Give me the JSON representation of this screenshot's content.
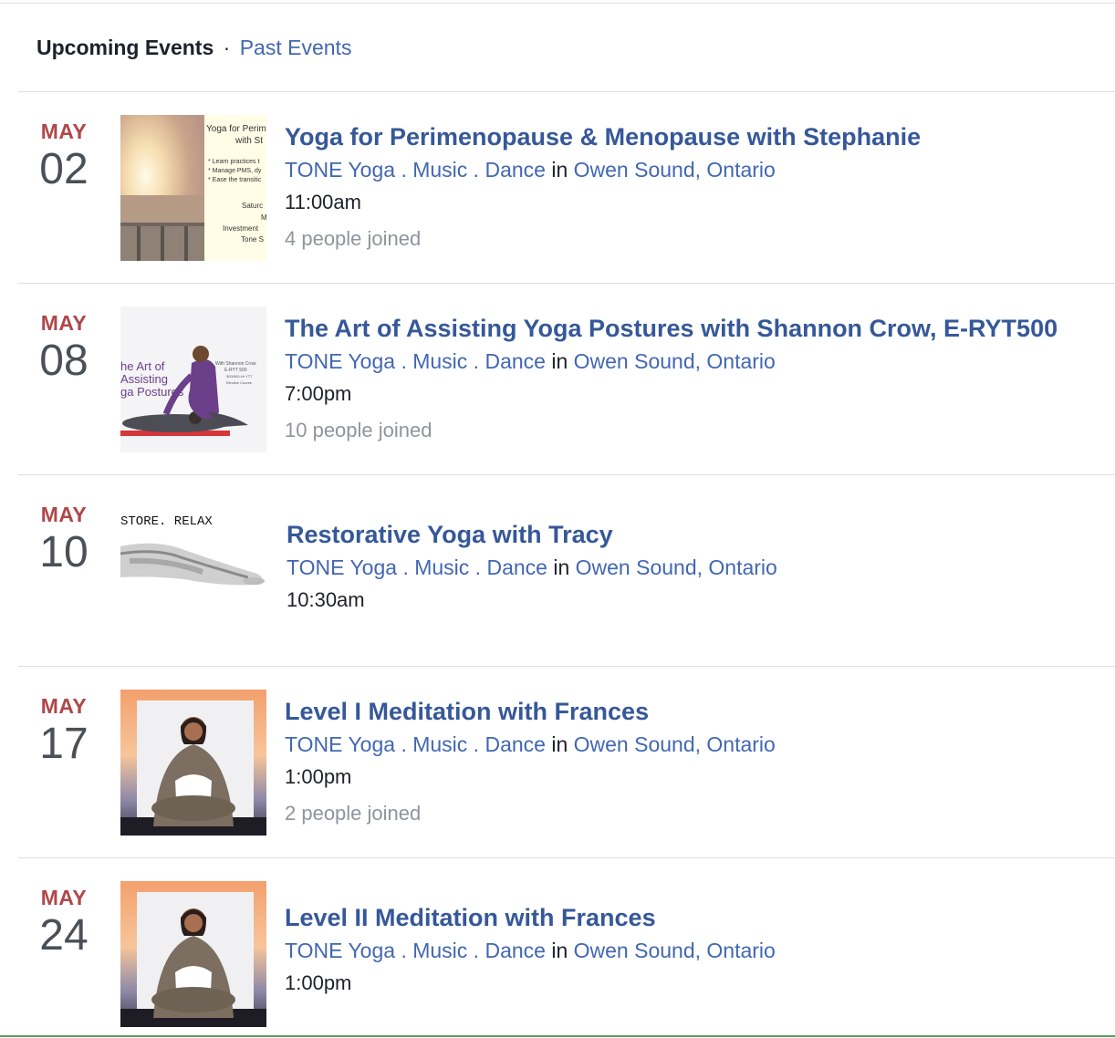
{
  "tabs": {
    "upcoming": "Upcoming Events",
    "separator": "·",
    "past": "Past Events"
  },
  "events": [
    {
      "month": "MAY",
      "day": "02",
      "title": "Yoga for Perimenopause & Menopause with Stephanie",
      "host": "TONE Yoga . Music . Dance",
      "in_word": "in",
      "location": "Owen Sound, Ontario",
      "time": "11:00am",
      "joined": "4 people joined",
      "poster": {
        "title_lines": [
          "Yoga for Perim",
          "with St"
        ],
        "bullets": [
          "* Learn practices t",
          "* Manage PMS, dy",
          "* Ease the transitic"
        ],
        "footer_lines": [
          "Saturc",
          "M",
          "Investment",
          "Tone S"
        ]
      }
    },
    {
      "month": "MAY",
      "day": "08",
      "title": "The Art of Assisting Yoga Postures with Shannon Crow, E-RYT500",
      "host": "TONE Yoga . Music . Dance",
      "in_word": "in",
      "location": "Owen Sound, Ontario",
      "time": "7:00pm",
      "joined": "10 people joined",
      "poster": {
        "title_lines": [
          "he Art of",
          "Assisting",
          "ga Postures"
        ],
        "side_lines": [
          "With Shannon Crow",
          "E-RYT 500",
          "300/500-Hr YTT",
          "Elective Course"
        ]
      }
    },
    {
      "month": "MAY",
      "day": "10",
      "title": "Restorative Yoga with Tracy",
      "host": "TONE Yoga . Music . Dance",
      "in_word": "in",
      "location": "Owen Sound, Ontario",
      "time": "10:30am",
      "joined": "",
      "poster": {
        "caption": "STORE. RELAX"
      }
    },
    {
      "month": "MAY",
      "day": "17",
      "title": "Level I Meditation with Frances",
      "host": "TONE Yoga . Music . Dance",
      "in_word": "in",
      "location": "Owen Sound, Ontario",
      "time": "1:00pm",
      "joined": "2 people joined",
      "poster": {}
    },
    {
      "month": "MAY",
      "day": "24",
      "title": "Level II Meditation with Frances",
      "host": "TONE Yoga . Music . Dance",
      "in_word": "in",
      "location": "Owen Sound, Ontario",
      "time": "1:00pm",
      "joined": "",
      "poster": {}
    }
  ]
}
